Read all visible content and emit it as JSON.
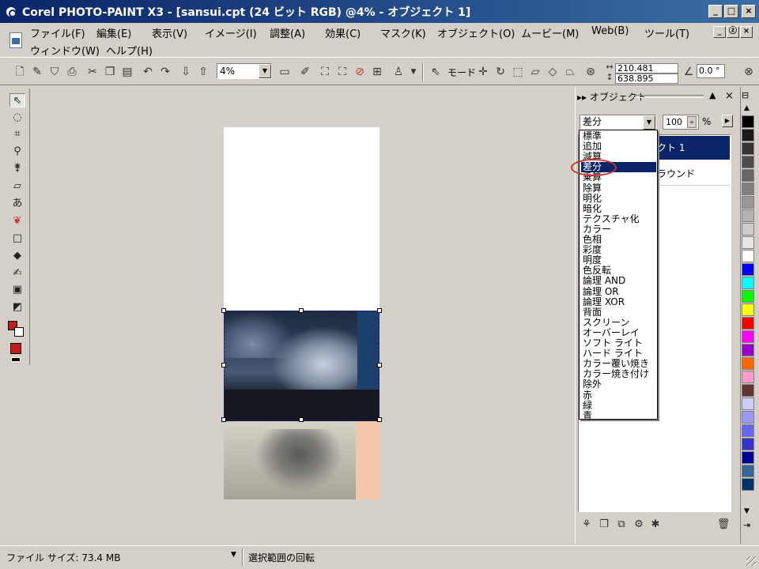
{
  "window": {
    "title": "Corel PHOTO-PAINT X3 - [sansui.cpt (24 ビット RGB) @4% - オブジェクト 1]",
    "min": "_",
    "max": "□",
    "close": "×"
  },
  "menu": {
    "items": [
      "ファイル(F)",
      "編集(E)",
      "表示(V)",
      "イメージ(I)",
      "調整(A)",
      "効果(C)",
      "マスク(K)",
      "オブジェクト(O)",
      "ムービー(M)",
      "Web(B)",
      "ツール(T)",
      "ウィンドウ(W)",
      "ヘルプ(H)"
    ],
    "mdi": [
      "_",
      "ⓩ",
      "×"
    ]
  },
  "toolbar": {
    "zoom": "4%",
    "mode_label": "モード",
    "x_coord": "210.481",
    "y_coord": "638.895",
    "angle": "0.0 °"
  },
  "objects_docker": {
    "title": "オブジェクト",
    "blend_mode": "差分",
    "opacity": "100",
    "opacity_unit": "%",
    "rows": [
      {
        "label": "クト 1",
        "selected": true
      },
      {
        "label": "ラウンド",
        "selected": false
      }
    ],
    "blend_options": [
      "標準",
      "追加",
      "減算",
      "差分",
      "乗算",
      "除算",
      "明化",
      "暗化",
      "テクスチャ化",
      "カラー",
      "色相",
      "彩度",
      "明度",
      "色反転",
      "論理 AND",
      "論理 OR",
      "論理 XOR",
      "背面",
      "スクリーン",
      "オーバーレイ",
      "ソフト ライト",
      "ハード ライト",
      "カラー覆い焼き",
      "カラー焼き付け",
      "除外",
      "赤",
      "緑",
      "青"
    ],
    "selected_index": 3
  },
  "palette": {
    "colors": [
      "#000000",
      "#1a1a1a",
      "#333333",
      "#4d4d4d",
      "#666666",
      "#808080",
      "#999999",
      "#b3b3b3",
      "#cccccc",
      "#e6e6e6",
      "#ffffff",
      "#0000ff",
      "#00ffff",
      "#00ff00",
      "#ffff00",
      "#ff0000",
      "#ff00ff",
      "#9900cc",
      "#ff6600",
      "#ff99cc",
      "#663333",
      "#ccccff",
      "#9999ff",
      "#6666ff",
      "#3333cc",
      "#000099",
      "#336699",
      "#003366"
    ]
  },
  "status": {
    "file_size": "ファイル サイズ: 73.4 MB",
    "message": "選択範囲の回転"
  }
}
